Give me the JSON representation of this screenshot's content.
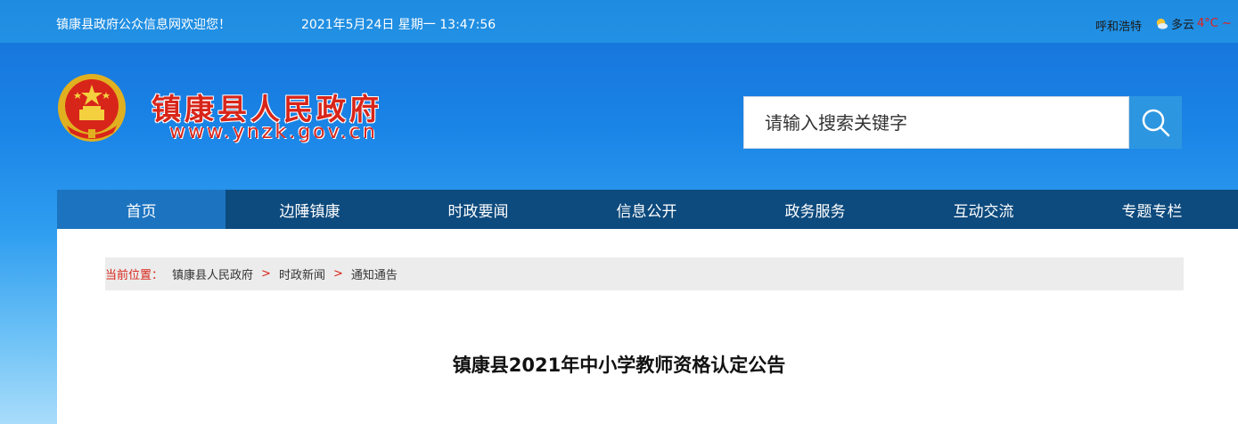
{
  "topbar": {
    "welcome": "镇康县政府公众信息网欢迎您！",
    "datetime": "2021年5月24日 星期一 13:47:56",
    "city": "呼和浩特",
    "weather_icon": "partly-cloudy-sun-icon",
    "weather_text": "多云",
    "temperature": "4°C ~"
  },
  "header": {
    "site_title": "镇康县人民政府",
    "site_url": "www.ynzk.gov.cn",
    "emblem_icon": "national-emblem-icon",
    "search_placeholder": "请输入搜索关键字",
    "search_icon": "search-icon"
  },
  "nav": {
    "items": [
      {
        "label": "首页",
        "active": true
      },
      {
        "label": "边陲镇康",
        "active": false
      },
      {
        "label": "时政要闻",
        "active": false
      },
      {
        "label": "信息公开",
        "active": false
      },
      {
        "label": "政务服务",
        "active": false
      },
      {
        "label": "互动交流",
        "active": false
      },
      {
        "label": "专题专栏",
        "active": false
      }
    ]
  },
  "breadcrumb": {
    "label": "当前位置：",
    "items": [
      "镇康县人民政府",
      "时政新闻",
      "通知通告"
    ],
    "separator": ">"
  },
  "article": {
    "title": "镇康县2021年中小学教师资格认定公告"
  },
  "colors": {
    "nav_bg": "#0d4a7d",
    "nav_active": "#1c74c0",
    "accent_red": "#d8251a",
    "search_btn": "#2d96e0"
  }
}
